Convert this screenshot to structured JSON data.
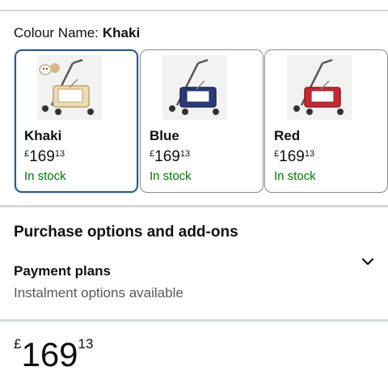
{
  "colour": {
    "label": "Colour Name:",
    "value": "Khaki"
  },
  "swatches": [
    {
      "name": "Khaki",
      "currency": "£",
      "whole": "169",
      "fraction": "13",
      "stock": "In stock",
      "fabric": "#e8dcc2",
      "trim": "#c9a15a"
    },
    {
      "name": "Blue",
      "currency": "£",
      "whole": "169",
      "fraction": "13",
      "stock": "In stock",
      "fabric": "#2b3a78",
      "trim": "#ffffff"
    },
    {
      "name": "Red",
      "currency": "£",
      "whole": "169",
      "fraction": "13",
      "stock": "In stock",
      "fabric": "#c42a32",
      "trim": "#ffffff"
    }
  ],
  "purchase_options": {
    "title": "Purchase options and add-ons"
  },
  "payment_plans": {
    "title": "Payment plans",
    "subtitle": "Instalment options available",
    "icon": "chevron-down-icon"
  },
  "price": {
    "currency": "£",
    "whole": "169",
    "fraction": "13"
  },
  "colors": {
    "in_stock": "#007600",
    "selected_border": "#2c5b7e",
    "divider": "#d5d9d9"
  }
}
